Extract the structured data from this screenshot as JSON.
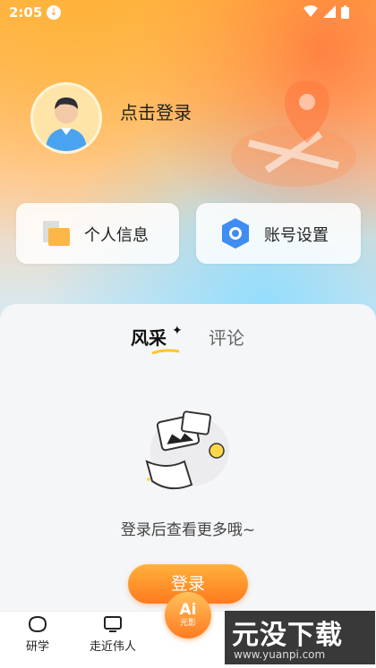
{
  "statusbar": {
    "time": "2:05"
  },
  "profile": {
    "login_prompt": "点击登录"
  },
  "cards": {
    "personal_info": "个人信息",
    "account_settings": "账号设置"
  },
  "tabs": {
    "fengcai": "风采",
    "pinglun": "评论"
  },
  "empty_state": {
    "message": "登录后查看更多哦~"
  },
  "login_button": {
    "label": "登录"
  },
  "tabbar": {
    "items": [
      {
        "label": "研学"
      },
      {
        "label": "走近伟人"
      }
    ],
    "ai_badge": {
      "title": "Ai",
      "subtitle": "光影"
    }
  },
  "watermark": {
    "main": "元没下载",
    "url": "www.yuanpi.com"
  },
  "colors": {
    "accent": "#ff8a2a",
    "text": "#222222"
  }
}
